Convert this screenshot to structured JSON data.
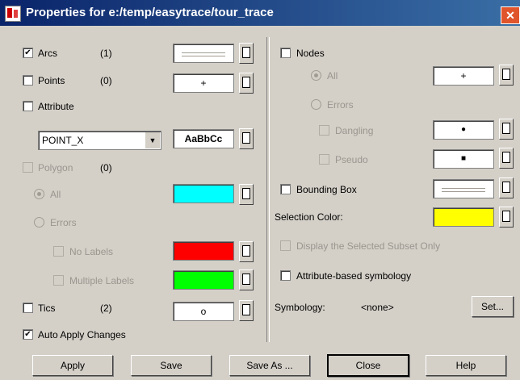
{
  "window": {
    "title": "Properties for e:/temp/easytrace/tour_trace",
    "close_glyph": "✕"
  },
  "left": {
    "arcs": {
      "label": "Arcs",
      "count": "(1)",
      "checked": true
    },
    "points": {
      "label": "Points",
      "count": "(0)",
      "checked": false,
      "symbol": "+"
    },
    "attribute": {
      "label": "Attribute",
      "checked": false,
      "select_value": "POINT_X",
      "font_sample": "AaBbCc"
    },
    "polygon": {
      "label": "Polygon",
      "count": "(0)",
      "all_label": "All",
      "errors_label": "Errors",
      "no_labels": "No Labels",
      "multiple_labels": "Multiple Labels",
      "all_color": "#00ffff",
      "no_labels_color": "#ff0000",
      "multiple_labels_color": "#00ff00"
    },
    "tics": {
      "label": "Tics",
      "count": "(2)",
      "checked": false,
      "symbol": "o"
    },
    "auto_apply": {
      "label": "Auto Apply Changes",
      "checked": true
    }
  },
  "right": {
    "nodes": {
      "label": "Nodes",
      "all_label": "All",
      "errors_label": "Errors",
      "dangling_label": "Dangling",
      "pseudo_label": "Pseudo",
      "all_symbol": "+",
      "dangling_symbol": "●",
      "pseudo_symbol": "■"
    },
    "bounding_box": {
      "label": "Bounding Box"
    },
    "selection_color": {
      "label": "Selection Color:",
      "color": "#ffff00"
    },
    "display_selected": {
      "label": "Display the Selected Subset Only"
    },
    "attribute_symbology": {
      "label": "Attribute-based symbology"
    },
    "symbology": {
      "label": "Symbology:",
      "value": "<none>",
      "set_label": "Set..."
    }
  },
  "buttons": {
    "apply": "Apply",
    "save": "Save",
    "save_as": "Save As ...",
    "close": "Close",
    "help": "Help"
  },
  "check_glyph": "✔",
  "dropdown_glyph": "▼"
}
